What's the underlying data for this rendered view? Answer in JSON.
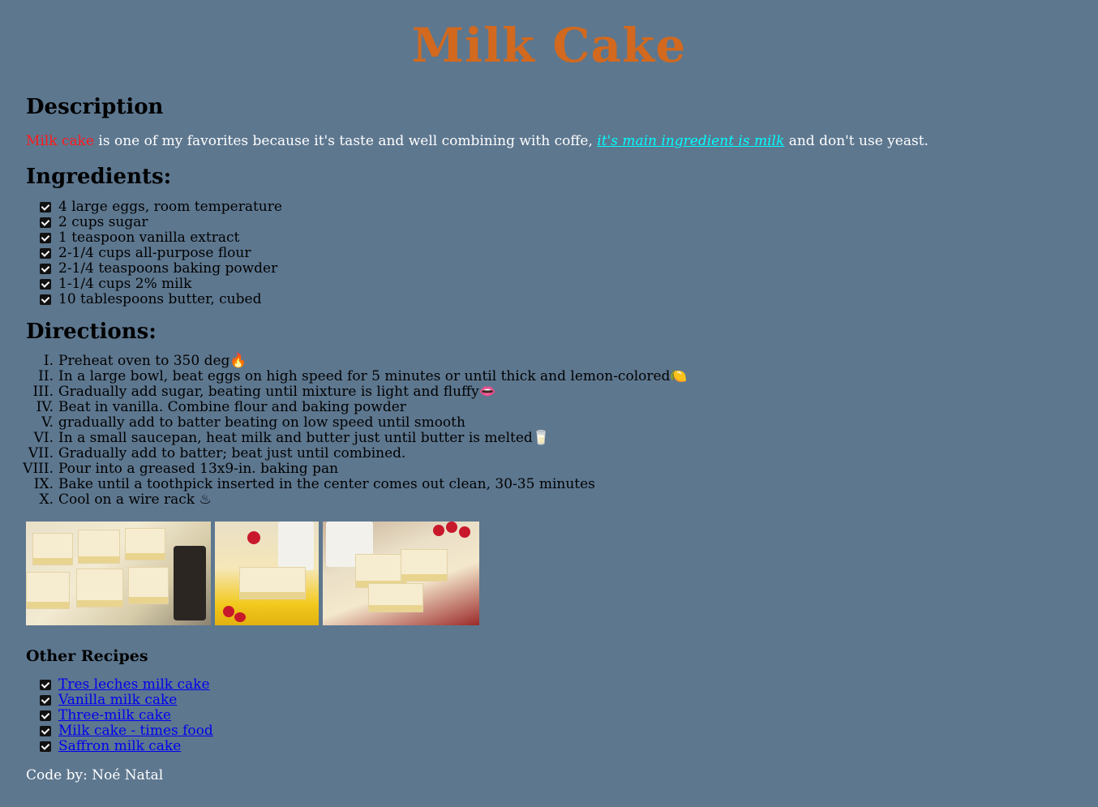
{
  "page": {
    "title": "Milk Cake",
    "title_color": "#d2691e",
    "background_color": "#5d778f"
  },
  "description": {
    "heading": "Description",
    "highlight": "Milk cake",
    "text_before_link": " is one of my favorites because it's taste and well combining with coffe, ",
    "link_text": "it's main ingredient is milk",
    "text_after_link": " and don't use yeast."
  },
  "ingredients": {
    "heading": "Ingredients:",
    "items": [
      "4 large eggs, room temperature",
      "2 cups sugar",
      "1 teaspoon vanilla extract",
      "2-1/4 cups all-purpose flour",
      "2-1/4 teaspoons baking powder",
      "1-1/4 cups 2% milk",
      "10 tablespoons butter, cubed"
    ]
  },
  "directions": {
    "heading": "Directions:",
    "numerals": [
      "I.",
      "II.",
      "III.",
      "IV.",
      "V.",
      "VI.",
      "VII.",
      "VIII.",
      "IX.",
      "X."
    ],
    "items": [
      "Preheat oven to 350 deg🔥",
      "In a large bowl, beat eggs on high speed for 5 minutes or until thick and lemon-colored🍋",
      "Gradually add sugar, beating until mixture is light and fluffy👄",
      "Beat in vanilla. Combine flour and baking powder",
      "gradually add to batter beating on low speed until smooth",
      "In a small saucepan, heat milk and butter just until butter is melted🥛",
      "Gradually add to batter; beat just until combined.",
      "Pour into a greased 13x9-in. baking pan",
      "Bake until a toothpick inserted in the center comes out clean, 30-35 minutes",
      "Cool on a wire rack ♨"
    ]
  },
  "other_recipes": {
    "heading": "Other Recipes",
    "links": [
      "Tres leches milk cake",
      "Vanilla milk cake",
      "Three-milk cake",
      "Milk cake - times food",
      "Saffron milk cake"
    ]
  },
  "footer": {
    "credit": "Code by: Noé Natal"
  }
}
